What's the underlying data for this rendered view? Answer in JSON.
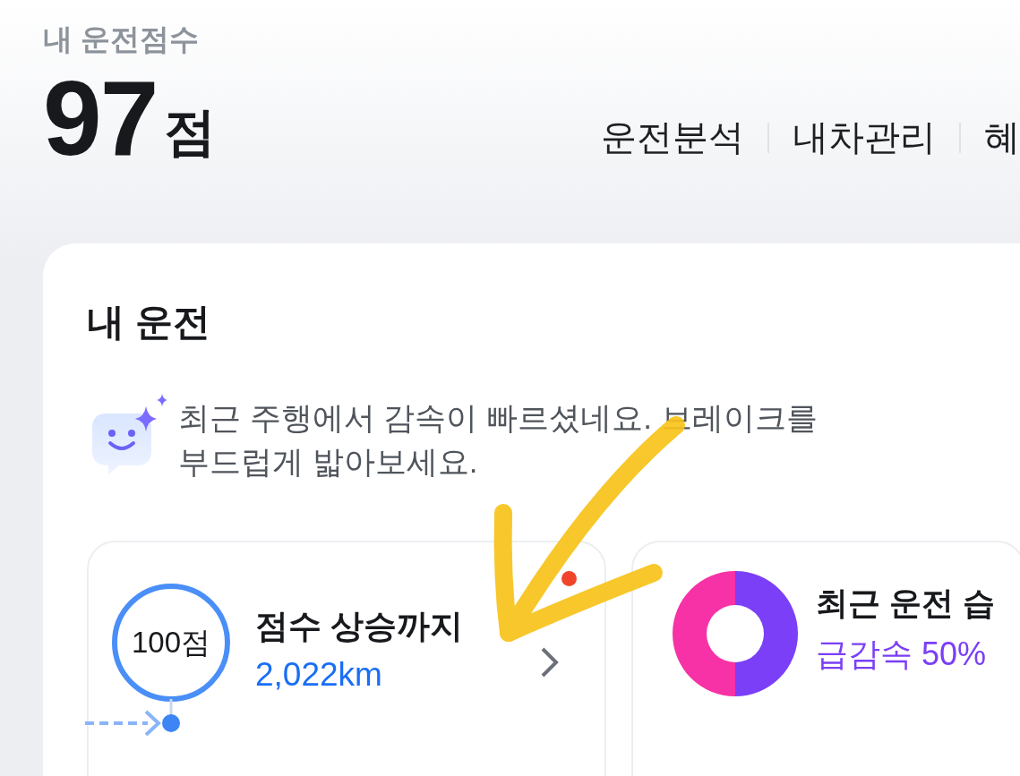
{
  "header": {
    "label": "내 운전점수",
    "score": "97",
    "unit": "점",
    "nav": [
      {
        "label": "운전분석"
      },
      {
        "label": "내차관리"
      },
      {
        "label": "혜"
      }
    ]
  },
  "card": {
    "title": "내 운전",
    "message": "최근 주행에서 감속이 빠르셨네요. 브레이크를 부드럽게 밟아보세요.",
    "tiles": [
      {
        "kind": "goal",
        "badge": "100점",
        "title": "점수 상승까지",
        "value": "2,022km",
        "new": true
      },
      {
        "kind": "habit",
        "title": "최근 운전 습",
        "value": "급감속 50%"
      }
    ]
  }
}
